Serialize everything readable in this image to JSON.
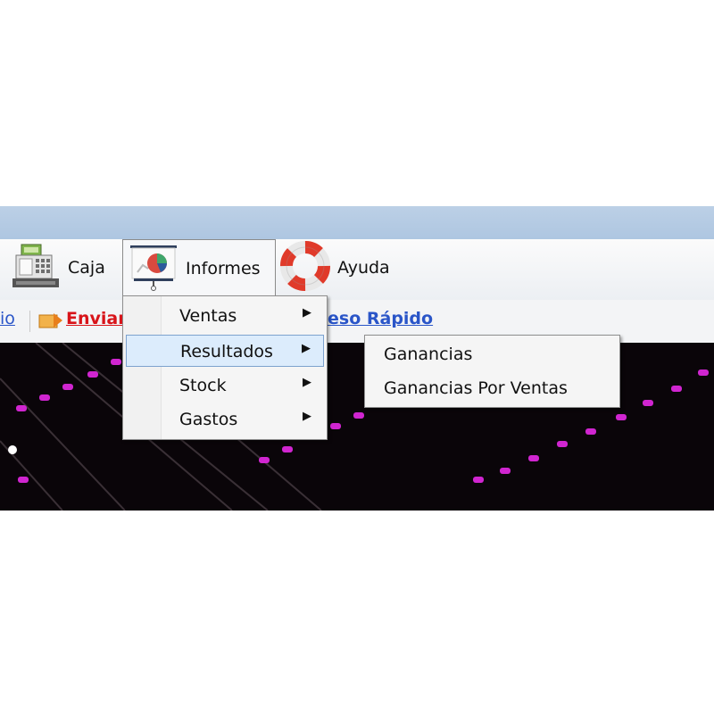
{
  "toolbar": {
    "caja": "Caja",
    "informes": "Informes",
    "ayuda": "Ayuda"
  },
  "quickbar": {
    "link_left": "io",
    "enviar": "Enviar",
    "acceso": "eso Rápido"
  },
  "informes_menu": {
    "items": [
      {
        "label": "Ventas"
      },
      {
        "label": "Resultados"
      },
      {
        "label": "Stock"
      },
      {
        "label": "Gastos"
      }
    ]
  },
  "resultados_submenu": {
    "items": [
      {
        "label": "Ganancias"
      },
      {
        "label": "Ganancias Por Ventas"
      }
    ]
  },
  "colors": {
    "link_blue": "#2a55c8",
    "link_red": "#d8141a",
    "highlight": "#dcecfc"
  }
}
